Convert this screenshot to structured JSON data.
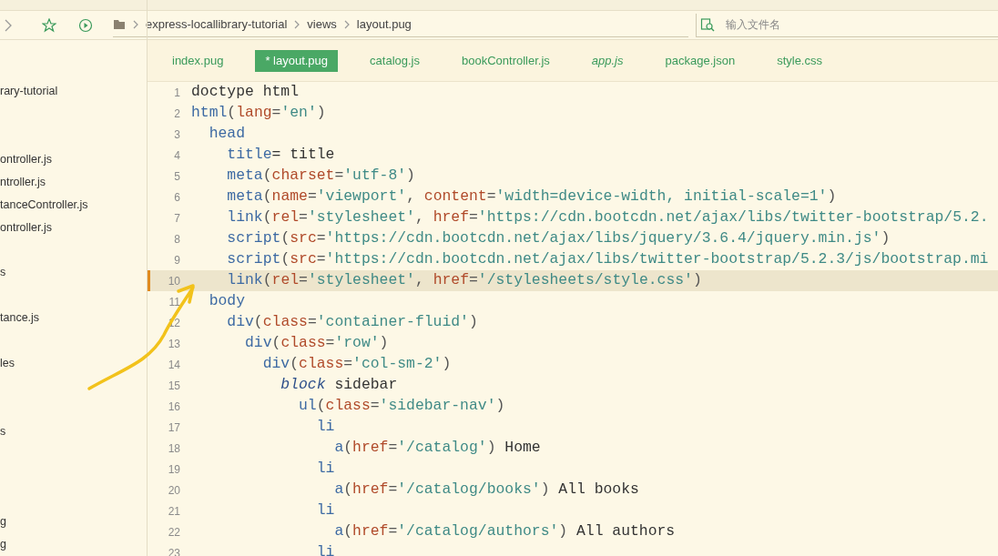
{
  "breadcrumb": [
    "express-locallibrary-tutorial",
    "views",
    "layout.pug"
  ],
  "search": {
    "placeholder": "输入文件名"
  },
  "sidebar": {
    "items": [
      {
        "kind": "file",
        "text": "rary-tutorial"
      },
      {
        "kind": "spacer"
      },
      {
        "kind": "spacer"
      },
      {
        "kind": "file",
        "text": "ontroller.js"
      },
      {
        "kind": "file",
        "text": "ntroller.js"
      },
      {
        "kind": "file",
        "text": "tanceController.js"
      },
      {
        "kind": "file",
        "text": "ontroller.js"
      },
      {
        "kind": "spacer"
      },
      {
        "kind": "file",
        "text": "s"
      },
      {
        "kind": "spacer"
      },
      {
        "kind": "file",
        "text": "tance.js"
      },
      {
        "kind": "spacer"
      },
      {
        "kind": "file",
        "text": "les"
      },
      {
        "kind": "spacer"
      },
      {
        "kind": "spacer"
      },
      {
        "kind": "file",
        "text": "s"
      },
      {
        "kind": "spacer"
      },
      {
        "kind": "spacer"
      },
      {
        "kind": "spacer"
      },
      {
        "kind": "file",
        "text": "g"
      },
      {
        "kind": "file",
        "text": "g"
      }
    ]
  },
  "tabs": [
    {
      "label": "index.pug",
      "selected": false,
      "italic": false
    },
    {
      "label": "* layout.pug",
      "selected": true,
      "italic": false
    },
    {
      "label": "catalog.js",
      "selected": false,
      "italic": false
    },
    {
      "label": "bookController.js",
      "selected": false,
      "italic": false
    },
    {
      "label": "app.js",
      "selected": false,
      "italic": true
    },
    {
      "label": "package.json",
      "selected": false,
      "italic": false
    },
    {
      "label": "style.css",
      "selected": false,
      "italic": false
    }
  ],
  "editor": {
    "lines": [
      {
        "number": "1",
        "current": false,
        "tokens": [
          {
            "kind": "text",
            "text": "doctype html"
          }
        ]
      },
      {
        "number": "2",
        "current": false,
        "tokens": [
          {
            "kind": "tag",
            "text": "html"
          },
          {
            "kind": "punct",
            "text": "("
          },
          {
            "kind": "attr",
            "text": "lang"
          },
          {
            "kind": "punct",
            "text": "="
          },
          {
            "kind": "string",
            "text": "'en'"
          },
          {
            "kind": "punct",
            "text": ")"
          }
        ]
      },
      {
        "number": "3",
        "current": false,
        "tokens": [
          {
            "kind": "tag",
            "text": "  head"
          }
        ]
      },
      {
        "number": "4",
        "current": false,
        "tokens": [
          {
            "kind": "tag",
            "text": "    title"
          },
          {
            "kind": "text",
            "text": "= title"
          }
        ]
      },
      {
        "number": "5",
        "current": false,
        "tokens": [
          {
            "kind": "tag",
            "text": "    meta"
          },
          {
            "kind": "punct",
            "text": "("
          },
          {
            "kind": "attr",
            "text": "charset"
          },
          {
            "kind": "punct",
            "text": "="
          },
          {
            "kind": "string",
            "text": "'utf-8'"
          },
          {
            "kind": "punct",
            "text": ")"
          }
        ]
      },
      {
        "number": "6",
        "current": false,
        "tokens": [
          {
            "kind": "tag",
            "text": "    meta"
          },
          {
            "kind": "punct",
            "text": "("
          },
          {
            "kind": "attr",
            "text": "name"
          },
          {
            "kind": "punct",
            "text": "="
          },
          {
            "kind": "string",
            "text": "'viewport'"
          },
          {
            "kind": "punct",
            "text": ", "
          },
          {
            "kind": "attr",
            "text": "content"
          },
          {
            "kind": "punct",
            "text": "="
          },
          {
            "kind": "string",
            "text": "'width=device-width, initial-scale=1'"
          },
          {
            "kind": "punct",
            "text": ")"
          }
        ]
      },
      {
        "number": "7",
        "current": false,
        "tokens": [
          {
            "kind": "tag",
            "text": "    link"
          },
          {
            "kind": "punct",
            "text": "("
          },
          {
            "kind": "attr",
            "text": "rel"
          },
          {
            "kind": "punct",
            "text": "="
          },
          {
            "kind": "string",
            "text": "'stylesheet'"
          },
          {
            "kind": "punct",
            "text": ", "
          },
          {
            "kind": "attr",
            "text": "href"
          },
          {
            "kind": "punct",
            "text": "="
          },
          {
            "kind": "string",
            "text": "'https://cdn.bootcdn.net/ajax/libs/twitter-bootstrap/5.2."
          }
        ]
      },
      {
        "number": "8",
        "current": false,
        "tokens": [
          {
            "kind": "tag",
            "text": "    script"
          },
          {
            "kind": "punct",
            "text": "("
          },
          {
            "kind": "attr",
            "text": "src"
          },
          {
            "kind": "punct",
            "text": "="
          },
          {
            "kind": "string",
            "text": "'https://cdn.bootcdn.net/ajax/libs/jquery/3.6.4/jquery.min.js'"
          },
          {
            "kind": "punct",
            "text": ")"
          }
        ]
      },
      {
        "number": "9",
        "current": false,
        "tokens": [
          {
            "kind": "tag",
            "text": "    script"
          },
          {
            "kind": "punct",
            "text": "("
          },
          {
            "kind": "attr",
            "text": "src"
          },
          {
            "kind": "punct",
            "text": "="
          },
          {
            "kind": "string",
            "text": "'https://cdn.bootcdn.net/ajax/libs/twitter-bootstrap/5.2.3/js/bootstrap.mi"
          }
        ]
      },
      {
        "number": "10",
        "current": true,
        "tokens": [
          {
            "kind": "tag",
            "text": "    link"
          },
          {
            "kind": "punct",
            "text": "("
          },
          {
            "kind": "attr",
            "text": "rel"
          },
          {
            "kind": "punct",
            "text": "="
          },
          {
            "kind": "string",
            "text": "'stylesheet'"
          },
          {
            "kind": "punct",
            "text": ", "
          },
          {
            "kind": "attr",
            "text": "href"
          },
          {
            "kind": "punct",
            "text": "="
          },
          {
            "kind": "string",
            "text": "'/stylesheets/style.css'"
          },
          {
            "kind": "punct",
            "text": ")"
          }
        ]
      },
      {
        "number": "11",
        "current": false,
        "tokens": [
          {
            "kind": "tag",
            "text": "  body"
          }
        ]
      },
      {
        "number": "12",
        "current": false,
        "tokens": [
          {
            "kind": "tag",
            "text": "    div"
          },
          {
            "kind": "punct",
            "text": "("
          },
          {
            "kind": "attr",
            "text": "class"
          },
          {
            "kind": "punct",
            "text": "="
          },
          {
            "kind": "string",
            "text": "'container-fluid'"
          },
          {
            "kind": "punct",
            "text": ")"
          }
        ]
      },
      {
        "number": "13",
        "current": false,
        "tokens": [
          {
            "kind": "tag",
            "text": "      div"
          },
          {
            "kind": "punct",
            "text": "("
          },
          {
            "kind": "attr",
            "text": "class"
          },
          {
            "kind": "punct",
            "text": "="
          },
          {
            "kind": "string",
            "text": "'row'"
          },
          {
            "kind": "punct",
            "text": ")"
          }
        ]
      },
      {
        "number": "14",
        "current": false,
        "tokens": [
          {
            "kind": "tag",
            "text": "        div"
          },
          {
            "kind": "punct",
            "text": "("
          },
          {
            "kind": "attr",
            "text": "class"
          },
          {
            "kind": "punct",
            "text": "="
          },
          {
            "kind": "string",
            "text": "'col-sm-2'"
          },
          {
            "kind": "punct",
            "text": ")"
          }
        ]
      },
      {
        "number": "15",
        "current": false,
        "tokens": [
          {
            "kind": "keyword",
            "text": "          block"
          },
          {
            "kind": "text",
            "text": " sidebar"
          }
        ]
      },
      {
        "number": "16",
        "current": false,
        "tokens": [
          {
            "kind": "tag",
            "text": "            ul"
          },
          {
            "kind": "punct",
            "text": "("
          },
          {
            "kind": "attr",
            "text": "class"
          },
          {
            "kind": "punct",
            "text": "="
          },
          {
            "kind": "string",
            "text": "'sidebar-nav'"
          },
          {
            "kind": "punct",
            "text": ")"
          }
        ]
      },
      {
        "number": "17",
        "current": false,
        "tokens": [
          {
            "kind": "tag",
            "text": "              li"
          }
        ]
      },
      {
        "number": "18",
        "current": false,
        "tokens": [
          {
            "kind": "tag",
            "text": "                a"
          },
          {
            "kind": "punct",
            "text": "("
          },
          {
            "kind": "attr",
            "text": "href"
          },
          {
            "kind": "punct",
            "text": "="
          },
          {
            "kind": "string",
            "text": "'/catalog'"
          },
          {
            "kind": "punct",
            "text": ")"
          },
          {
            "kind": "text",
            "text": " Home"
          }
        ]
      },
      {
        "number": "19",
        "current": false,
        "tokens": [
          {
            "kind": "tag",
            "text": "              li"
          }
        ]
      },
      {
        "number": "20",
        "current": false,
        "tokens": [
          {
            "kind": "tag",
            "text": "                a"
          },
          {
            "kind": "punct",
            "text": "("
          },
          {
            "kind": "attr",
            "text": "href"
          },
          {
            "kind": "punct",
            "text": "="
          },
          {
            "kind": "string",
            "text": "'/catalog/books'"
          },
          {
            "kind": "punct",
            "text": ")"
          },
          {
            "kind": "text",
            "text": " All books"
          }
        ]
      },
      {
        "number": "21",
        "current": false,
        "tokens": [
          {
            "kind": "tag",
            "text": "              li"
          }
        ]
      },
      {
        "number": "22",
        "current": false,
        "tokens": [
          {
            "kind": "tag",
            "text": "                a"
          },
          {
            "kind": "punct",
            "text": "("
          },
          {
            "kind": "attr",
            "text": "href"
          },
          {
            "kind": "punct",
            "text": "="
          },
          {
            "kind": "string",
            "text": "'/catalog/authors'"
          },
          {
            "kind": "punct",
            "text": ")"
          },
          {
            "kind": "text",
            "text": " All authors"
          }
        ]
      },
      {
        "number": "23",
        "current": false,
        "tokens": [
          {
            "kind": "tag",
            "text": "              li"
          }
        ]
      }
    ]
  }
}
